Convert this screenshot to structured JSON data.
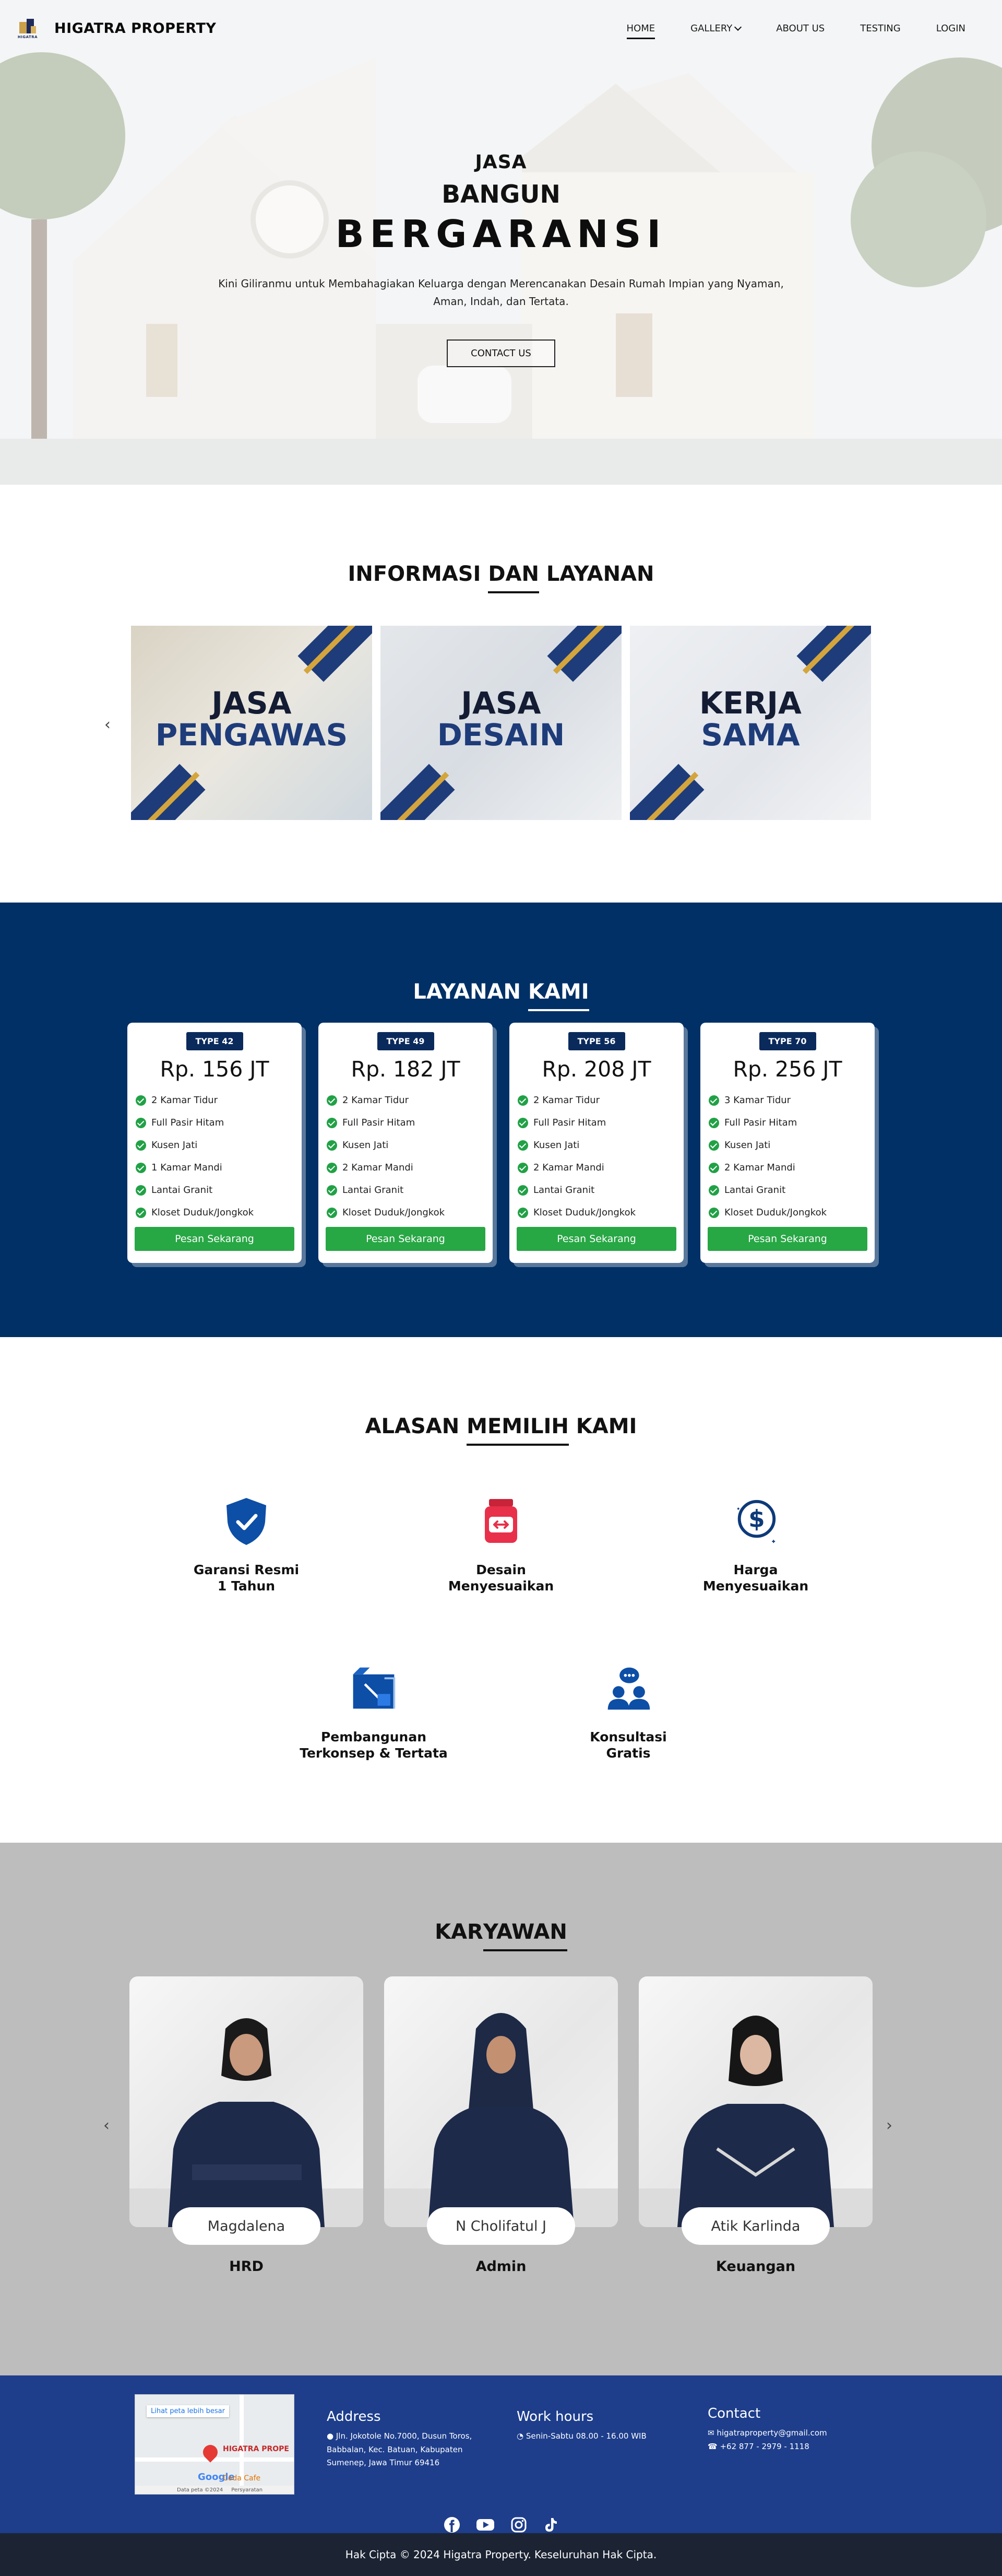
{
  "navbar": {
    "brand": "HIGATRA PROPERTY",
    "logo_text": "HIGATRA",
    "menu": [
      "HOME",
      "GALLERY",
      "ABOUT US",
      "TESTING",
      "LOGIN"
    ]
  },
  "hero": {
    "line1": "JASA",
    "line2": "BANGUN",
    "line3": "BERGARANSI",
    "description": "Kini Giliranmu untuk Membahagiakan Keluarga dengan Merencanakan Desain Rumah Impian yang Nyaman, Aman, Indah, dan Tertata.",
    "button": "CONTACT US"
  },
  "informasi": {
    "title_a": "INFORMASI ",
    "title_b": "DAN",
    "title_c": " LAYANAN",
    "prev": "‹",
    "cards": [
      {
        "l1": "JASA",
        "l2": "PENGAWAS"
      },
      {
        "l1": "JASA",
        "l2": "DESAIN"
      },
      {
        "l1": "KERJA",
        "l2": "SAMA"
      }
    ]
  },
  "layanan": {
    "title_a": "LAYANAN ",
    "title_b": "KAMI",
    "order_label": "Pesan Sekarang",
    "cards": [
      {
        "type": "TYPE 42",
        "price": "Rp. 156 JT",
        "features": [
          "2 Kamar Tidur",
          "Full Pasir Hitam",
          "Kusen Jati",
          "1 Kamar Mandi",
          "Lantai Granit",
          "Kloset Duduk/Jongkok"
        ]
      },
      {
        "type": "TYPE 49",
        "price": "Rp. 182 JT",
        "features": [
          "2 Kamar Tidur",
          "Full Pasir Hitam",
          "Kusen Jati",
          "2 Kamar Mandi",
          "Lantai Granit",
          "Kloset Duduk/Jongkok"
        ]
      },
      {
        "type": "TYPE 56",
        "price": "Rp. 208 JT",
        "features": [
          "2 Kamar Tidur",
          "Full Pasir Hitam",
          "Kusen Jati",
          "2 Kamar Mandi",
          "Lantai Granit",
          "Kloset Duduk/Jongkok"
        ]
      },
      {
        "type": "TYPE 70",
        "price": "Rp. 256 JT",
        "features": [
          "3 Kamar Tidur",
          "Full Pasir Hitam",
          "Kusen Jati",
          "2 Kamar Mandi",
          "Lantai Granit",
          "Kloset Duduk/Jongkok"
        ]
      }
    ]
  },
  "alasan": {
    "title_a": "ALASAN ",
    "title_b": "MEMILIH",
    "title_c": " KAMI",
    "items": [
      {
        "line1": "Garansi Resmi",
        "line2": "1 Tahun",
        "icon": "shield-check-icon",
        "color": "#0d4ea6"
      },
      {
        "line1": "Desain",
        "line2": "Menyesuaikan",
        "icon": "jar-icon",
        "color": "#e8304a"
      },
      {
        "line1": "Harga",
        "line2": "Menyesuaikan",
        "icon": "dollar-coin-icon",
        "color": "#0d3a7a"
      },
      {
        "line1": "Pembangunan",
        "line2": "Terkonsep & Tertata",
        "icon": "blueprint-icon",
        "color": "#0d4ea6"
      },
      {
        "line1": "Konsultasi",
        "line2": "Gratis",
        "icon": "consultation-icon",
        "color": "#0d4ea6"
      }
    ]
  },
  "karyawan": {
    "title_a": "KAR",
    "title_b": "YAWAN",
    "prev": "‹",
    "next": "›",
    "employees": [
      {
        "name": "Magdalena",
        "role": "HRD"
      },
      {
        "name": "N Cholifatul J",
        "role": "Admin"
      },
      {
        "name": "Atik Karlinda",
        "role": "Keuangan"
      }
    ]
  },
  "footer": {
    "map_link": "Lihat peta lebih besar",
    "map_label": "HIGATRA PROPE",
    "map_google": "Google",
    "map_cafe": "Coda Cafe",
    "map_data": "Data peta ©2024",
    "map_terms": "Persyaratan",
    "address_title": "Address",
    "address": "Jln. Jokotole No.7000, Dusun Toros, Babbalan, Kec. Batuan, Kabupaten Sumenep, Jawa Timur 69416",
    "work_title": "Work hours",
    "work": "Senin-Sabtu 08.00 - 16.00 WIB",
    "contact_title": "Contact",
    "email": "higatraproperty@gmail.com",
    "phone": "+62 877 - 2979 - 1118",
    "copyright": "Hak Cipta © 2024 Higatra Property. Keseluruhan Hak Cipta."
  }
}
